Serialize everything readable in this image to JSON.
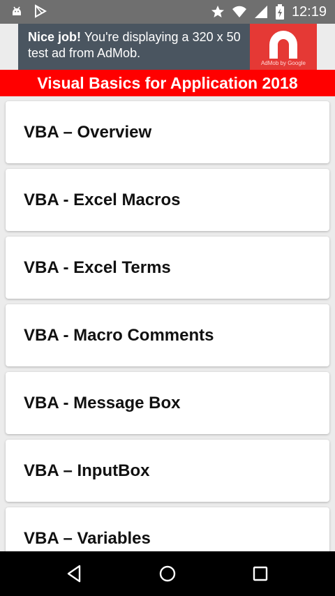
{
  "status_bar": {
    "time": "12:19",
    "left_icons": [
      "android-debug-icon",
      "play-store-icon"
    ],
    "right_icons": [
      "star-icon",
      "wifi-icon",
      "signal-icon",
      "battery-icon"
    ]
  },
  "ad": {
    "bold_text": "Nice job!",
    "text": " You're displaying a 320 x 50 test ad from AdMob.",
    "brand": "AdMob by Google",
    "accent_color": "#e53935",
    "background_color": "#4a5560"
  },
  "header": {
    "title": "Visual Basics for Application 2018",
    "color": "#ff0000"
  },
  "list": {
    "items": [
      {
        "label": "VBA – Overview"
      },
      {
        "label": "VBA - Excel Macros"
      },
      {
        "label": "VBA - Excel Terms"
      },
      {
        "label": "VBA - Macro Comments"
      },
      {
        "label": "VBA - Message Box"
      },
      {
        "label": "VBA – InputBox"
      },
      {
        "label": "VBA – Variables"
      }
    ]
  },
  "nav_bar": {
    "buttons": [
      "back-icon",
      "home-icon",
      "recents-icon"
    ]
  }
}
